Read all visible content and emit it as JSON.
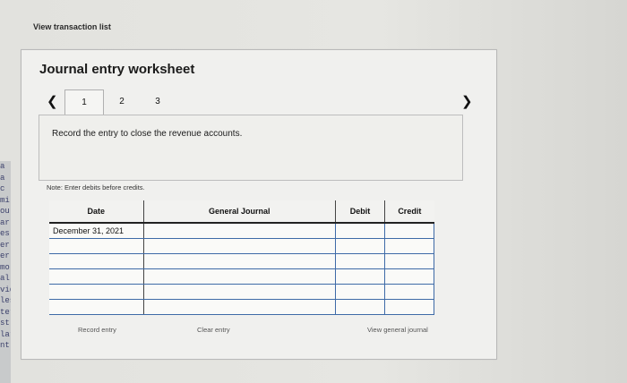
{
  "header": {
    "view_transaction_list": "View transaction list"
  },
  "worksheet": {
    "title": "Journal entry worksheet",
    "tabs": [
      "1",
      "2",
      "3"
    ],
    "active_tab": "1",
    "instruction": "Record the entry to close the revenue accounts.",
    "note": "Note: Enter debits before credits."
  },
  "journal": {
    "columns": {
      "date": "Date",
      "general_journal": "General Journal",
      "debit": "Debit",
      "credit": "Credit"
    },
    "rows": [
      {
        "date": "December 31, 2021",
        "account": "",
        "debit": "",
        "credit": ""
      },
      {
        "date": "",
        "account": "",
        "debit": "",
        "credit": ""
      },
      {
        "date": "",
        "account": "",
        "debit": "",
        "credit": ""
      },
      {
        "date": "",
        "account": "",
        "debit": "",
        "credit": ""
      },
      {
        "date": "",
        "account": "",
        "debit": "",
        "credit": ""
      },
      {
        "date": "",
        "account": "",
        "debit": "",
        "credit": ""
      }
    ]
  },
  "buttons": {
    "record_entry": "Record entry",
    "clear_entry": "Clear entry",
    "view_general_journal": "View general journal"
  },
  "left_strip": [
    "a",
    "a",
    "c",
    "mi",
    "ou",
    "ar",
    "es",
    "er",
    "er",
    "mo",
    "al",
    "vid",
    "les",
    "ter",
    "st",
    "lar",
    "nt"
  ]
}
